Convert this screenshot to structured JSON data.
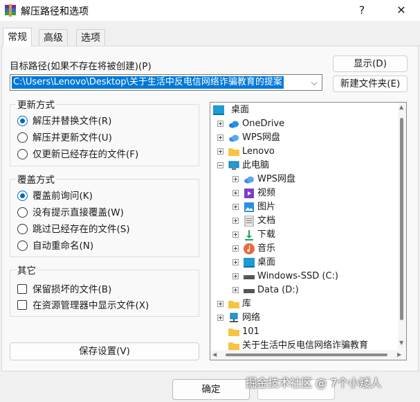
{
  "window": {
    "title": "解压路径和选项",
    "help_glyph": "?",
    "close_glyph": "✕"
  },
  "tabs": [
    {
      "label": "常规",
      "active": true
    },
    {
      "label": "高级",
      "active": false
    },
    {
      "label": "选项",
      "active": false
    }
  ],
  "general": {
    "target_label": "目标路径(如果不存在将被创建)(P)",
    "target_value": "C:\\Users\\Lenovo\\Desktop\\关于生活中反电信网络诈骗教育的提案",
    "show_button": "显示(D)",
    "new_folder_button": "新建文件夹(E)",
    "update_mode": {
      "title": "更新方式",
      "options": [
        {
          "label": "解压并替换文件(R)",
          "checked": true
        },
        {
          "label": "解压并更新文件(U)",
          "checked": false
        },
        {
          "label": "仅更新已经存在的文件(F)",
          "checked": false
        }
      ]
    },
    "overwrite_mode": {
      "title": "覆盖方式",
      "options": [
        {
          "label": "覆盖前询问(K)",
          "checked": true
        },
        {
          "label": "没有提示直接覆盖(W)",
          "checked": false
        },
        {
          "label": "跳过已经存在的文件(S)",
          "checked": false
        },
        {
          "label": "自动重命名(N)",
          "checked": false
        }
      ]
    },
    "misc": {
      "title": "其它",
      "options": [
        {
          "label": "保留损坏的文件(B)",
          "checked": false
        },
        {
          "label": "在资源管理器中显示文件(X)",
          "checked": false
        }
      ]
    },
    "save_settings_button": "保存设置(V)"
  },
  "tree": {
    "items": [
      {
        "label": "桌面",
        "icon": "desktop-icon"
      },
      {
        "label": "OneDrive",
        "icon": "cloud-icon"
      },
      {
        "label": "WPS网盘",
        "icon": "cloud-icon"
      },
      {
        "label": "Lenovo",
        "icon": "folder-icon"
      },
      {
        "label": "此电脑",
        "icon": "computer-icon"
      },
      {
        "label": "WPS网盘",
        "icon": "cloud-icon"
      },
      {
        "label": "视频",
        "icon": "video-icon"
      },
      {
        "label": "图片",
        "icon": "picture-icon"
      },
      {
        "label": "文档",
        "icon": "document-icon"
      },
      {
        "label": "下载",
        "icon": "download-icon"
      },
      {
        "label": "音乐",
        "icon": "music-icon"
      },
      {
        "label": "桌面",
        "icon": "desktop-icon"
      },
      {
        "label": "Windows-SSD (C:)",
        "icon": "drive-icon"
      },
      {
        "label": "Data (D:)",
        "icon": "drive-icon"
      },
      {
        "label": "库",
        "icon": "folder-icon"
      },
      {
        "label": "网络",
        "icon": "network-icon"
      },
      {
        "label": "101",
        "icon": "folder-icon"
      },
      {
        "label": "关于生活中反电信网络诈骗教育",
        "icon": "folder-icon"
      }
    ]
  },
  "footer": {
    "ok_button": "确定",
    "watermark": "掘金技术社区 @ 7个小矮人"
  },
  "colors": {
    "accent": "#0078d7",
    "radio_accent": "#0067c0",
    "folder": "#f5c542"
  }
}
